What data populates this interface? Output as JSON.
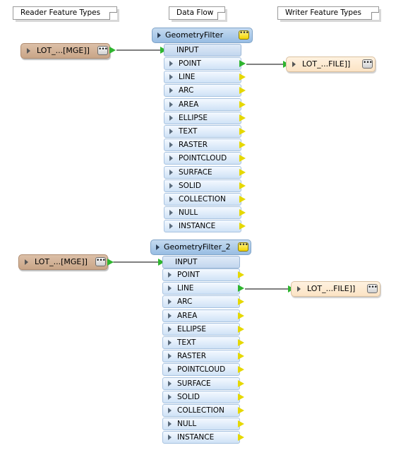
{
  "headers": {
    "reader": "Reader Feature Types",
    "flow": "Data Flow",
    "writer": "Writer Feature Types"
  },
  "readers": [
    {
      "label": "LOT_...[MGE]]",
      "dots": "•••"
    },
    {
      "label": "LOT_...[MGE]]",
      "dots": "•••"
    }
  ],
  "writers": [
    {
      "label": "LOT_...FILE]]",
      "dots": "•••"
    },
    {
      "label": "LOT_...FILE]]",
      "dots": "•••"
    }
  ],
  "transformers": [
    {
      "title": "GeometryFilter",
      "dots": "•••",
      "input": "INPUT",
      "ports": [
        "POINT",
        "LINE",
        "ARC",
        "AREA",
        "ELLIPSE",
        "TEXT",
        "RASTER",
        "POINTCLOUD",
        "SURFACE",
        "SOLID",
        "COLLECTION",
        "NULL",
        "INSTANCE"
      ],
      "connected_port": "POINT"
    },
    {
      "title": "GeometryFilter_2",
      "dots": "•••",
      "input": "INPUT",
      "ports": [
        "POINT",
        "LINE",
        "ARC",
        "AREA",
        "ELLIPSE",
        "TEXT",
        "RASTER",
        "POINTCLOUD",
        "SURFACE",
        "SOLID",
        "COLLECTION",
        "NULL",
        "INSTANCE"
      ],
      "connected_port": "LINE"
    }
  ],
  "colors": {
    "connected_arrow": "#2fb52f",
    "unconnected_arrow": "#e6d800",
    "link_line": "#000000"
  }
}
